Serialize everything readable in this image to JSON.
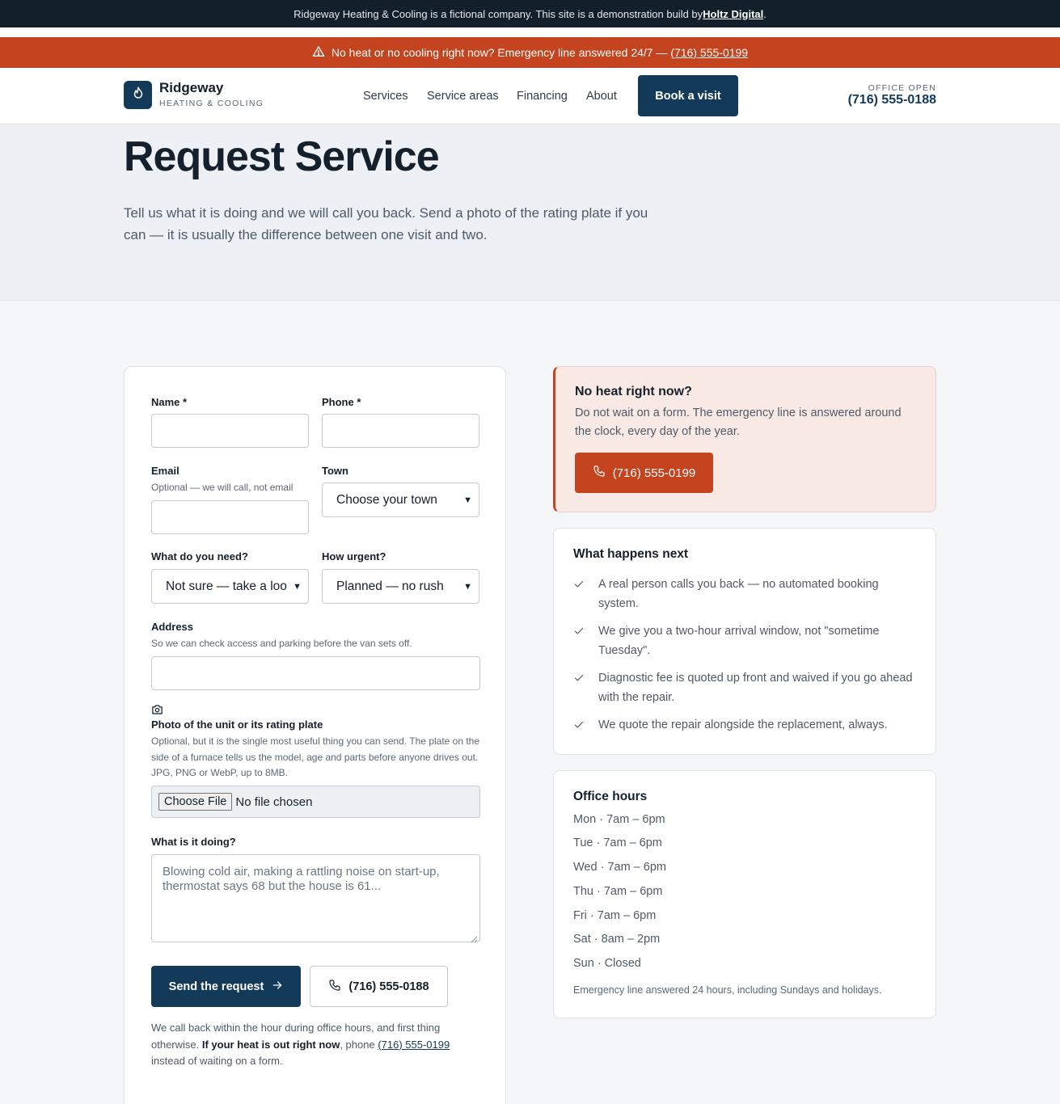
{
  "topbar": {
    "text": "Ridgeway Heating & Cooling is a fictional company. This site is a demonstration build by ",
    "link": "Holtz Digital",
    "suffix": "."
  },
  "alert": {
    "text": "No heat or no cooling right now? Emergency line answered 24/7 — ",
    "phone": "(716) 555-0199",
    "icon": "warning-triangle-icon"
  },
  "header": {
    "brand_name": "Ridgeway",
    "brand_sub": "HEATING & COOLING",
    "nav": [
      "Services",
      "Service areas",
      "Financing",
      "About"
    ],
    "book_label": "Book a visit",
    "office_status": "OFFICE OPEN",
    "office_phone": "(716) 555-0188",
    "logo_icon": "flame-icon"
  },
  "hero": {
    "title": "Request Service",
    "subtitle": "Tell us what it is doing and we will call you back. Send a photo of the rating plate if you can — it is usually the difference between one visit and two."
  },
  "form": {
    "name_label": "Name *",
    "phone_label": "Phone *",
    "email_label": "Email",
    "email_hint": "Optional — we will call, not email",
    "town_label": "Town",
    "town_value": "Choose your town",
    "need_label": "What do you need?",
    "need_value": "Not sure — take a loo",
    "urgency_label": "How urgent?",
    "urgency_value": "Planned — no rush",
    "address_label": "Address",
    "address_hint": "So we can check access and parking before the van sets off.",
    "photo_label": "Photo of the unit or its rating plate",
    "photo_hint": "Optional, but it is the single most useful thing you can send. The plate on the side of a furnace tells us the model, age and parts before anyone drives out. JPG, PNG or WebP, up to 8MB.",
    "file_button": "Choose File",
    "file_status": "No file chosen",
    "doing_label": "What is it doing?",
    "doing_placeholder": "Blowing cold air, making a rattling noise on start-up, thermostat says 68 but the house is 61...",
    "send_label": "Send the request",
    "call_label": "(716) 555-0188",
    "footnote_a": "We call back within the hour during office hours, and first thing otherwise. ",
    "footnote_b": "If your heat is out right now",
    "footnote_c": ", phone ",
    "footnote_phone": "(716) 555-0199",
    "footnote_d": " instead of waiting on a form."
  },
  "emergency": {
    "title": "No heat right now?",
    "text": "Do not wait on a form. The emergency line is answered around the clock, every day of the year.",
    "button": "(716) 555-0199"
  },
  "next": {
    "title": "What happens next",
    "items": [
      "A real person calls you back — no automated booking system.",
      "We give you a two-hour arrival window, not \"sometime Tuesday\".",
      "Diagnostic fee is quoted up front and waived if you go ahead with the repair.",
      "We quote the repair alongside the replacement, always."
    ]
  },
  "hours": {
    "title": "Office hours",
    "rows": [
      "Mon · 7am – 6pm",
      "Tue · 7am – 6pm",
      "Wed · 7am – 6pm",
      "Thu · 7am – 6pm",
      "Fri · 7am – 6pm",
      "Sat · 8am – 2pm",
      "Sun · Closed"
    ],
    "note": "Emergency line answered 24 hours, including Sundays and holidays."
  },
  "colors": {
    "navy": "#143a5a",
    "brand_orange": "#c4441f",
    "dark_bar": "#13202c"
  }
}
